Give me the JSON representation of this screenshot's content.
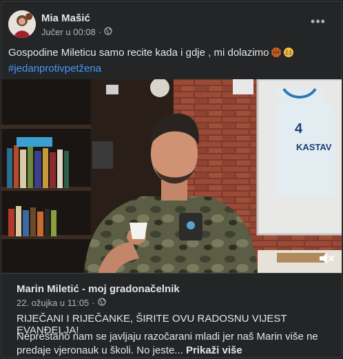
{
  "post": {
    "author": "Mia Mašić",
    "timestamp": "Jučer u 00:08",
    "separator": "·",
    "privacy_icon": "globe-icon",
    "more_label": "•••",
    "caption": "Gospodine Mileticu samo recite kada i gdje , mi dolazimo",
    "caption_emojis": [
      "basketball-emoji",
      "grinning-face-emoji"
    ],
    "hashtag": "#jedanprotivpetžena"
  },
  "video": {
    "jersey_number": "4",
    "jersey_text": "KASTAV",
    "mute_icon": "speaker-muted-icon"
  },
  "shared_post": {
    "author": "Marin Miletić - moj gradonačelnik",
    "timestamp": "22. ožujka u 11:05",
    "separator": "·",
    "privacy_icon": "globe-icon",
    "headline": "RIJEČANI I RIJEČANKE, ŠIRITE OVU RADOSNU VIJEST EVANĐELJA!",
    "body": "Neprestano nam se javljaju razočarani mladi jer naš Marin više ne predaje vjeronauk u školi. No jeste...",
    "see_more": "Prikaži više"
  },
  "colors": {
    "background": "#242526",
    "text": "#e4e6eb",
    "secondary_text": "#b0b3b8",
    "link": "#4599ff"
  }
}
